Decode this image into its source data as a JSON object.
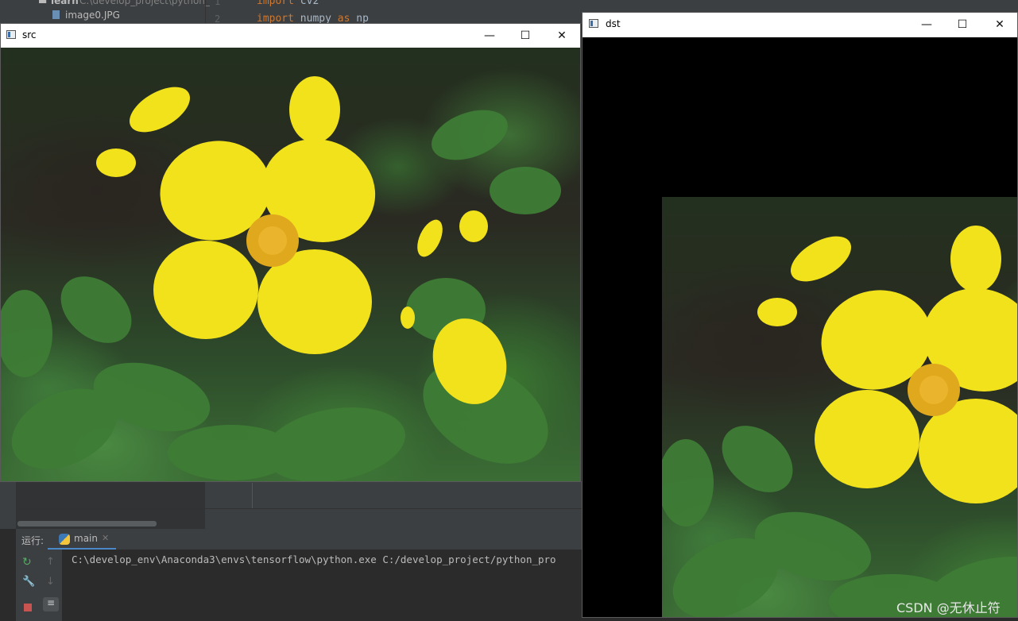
{
  "ide": {
    "tree": {
      "folder_name": "learn",
      "folder_path": "C:\\develop_project\\python_",
      "file_name": "image0.JPG"
    },
    "editor": {
      "line_numbers": [
        "1",
        "2"
      ],
      "line1_keyword": "import",
      "line1_module": "cv2",
      "line2_keyword": "import",
      "line2_module": "numpy",
      "line2_as": "as",
      "line2_alias": "np"
    },
    "run_panel": {
      "label": "运行:",
      "tab_label": "main",
      "console_line": "C:\\develop_env\\Anaconda3\\envs\\tensorflow\\python.exe C:/develop_project/python_pro"
    }
  },
  "windows": {
    "src": {
      "title": "src"
    },
    "dst": {
      "title": "dst"
    }
  },
  "controls": {
    "minimize": "—",
    "maximize": "☐",
    "close": "✕"
  },
  "watermark": "CSDN @无休止符",
  "colors": {
    "petal": "#f2e21c",
    "center": "#e0a81c",
    "leaf": "#3f7a3a",
    "dst_background": "#000000",
    "ide_background": "#2b2b2b"
  }
}
